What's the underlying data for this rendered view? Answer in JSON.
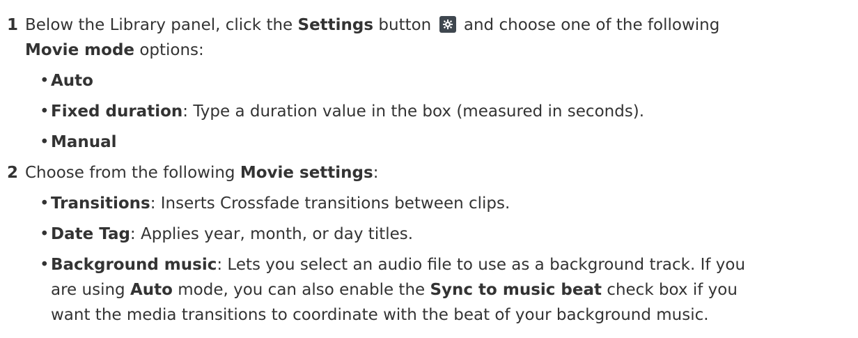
{
  "steps": [
    {
      "number": "1",
      "line1_prefix": "Below the Library panel, click the ",
      "line1_bold": "Settings",
      "line1_mid": " button",
      "line1_suffix": " and choose one of the following",
      "line2_bold": "Movie mode",
      "line2_suffix": " options:",
      "icon": "gear-icon",
      "bullets": [
        {
          "bold": "Auto",
          "text": ""
        },
        {
          "bold": "Fixed duration",
          "text": ": Type a duration value in the box (measured in seconds)."
        },
        {
          "bold": "Manual",
          "text": ""
        }
      ]
    },
    {
      "number": "2",
      "line1_prefix": "Choose from the following ",
      "line1_bold": "Movie settings",
      "line1_suffix": ":",
      "bullets": [
        {
          "bold": "Transitions",
          "text": ": Inserts Crossfade transitions between clips."
        },
        {
          "bold": "Date Tag",
          "text": ": Applies year, month, or day titles."
        }
      ],
      "bg_music": {
        "bold": "Background music",
        "line1": ": Lets you select an audio file to use as a background track. If you",
        "line2_prefix": "are using ",
        "line2_bold1": "Auto",
        "line2_mid": " mode, you can also enable the ",
        "line2_bold2": "Sync to music beat",
        "line2_suffix": " check box if you",
        "line3": "want the media transitions to coordinate with the beat of your background music."
      }
    }
  ],
  "bullet_char": "•",
  "colors": {
    "text": "#333333",
    "icon_bg": "#3f474f"
  }
}
